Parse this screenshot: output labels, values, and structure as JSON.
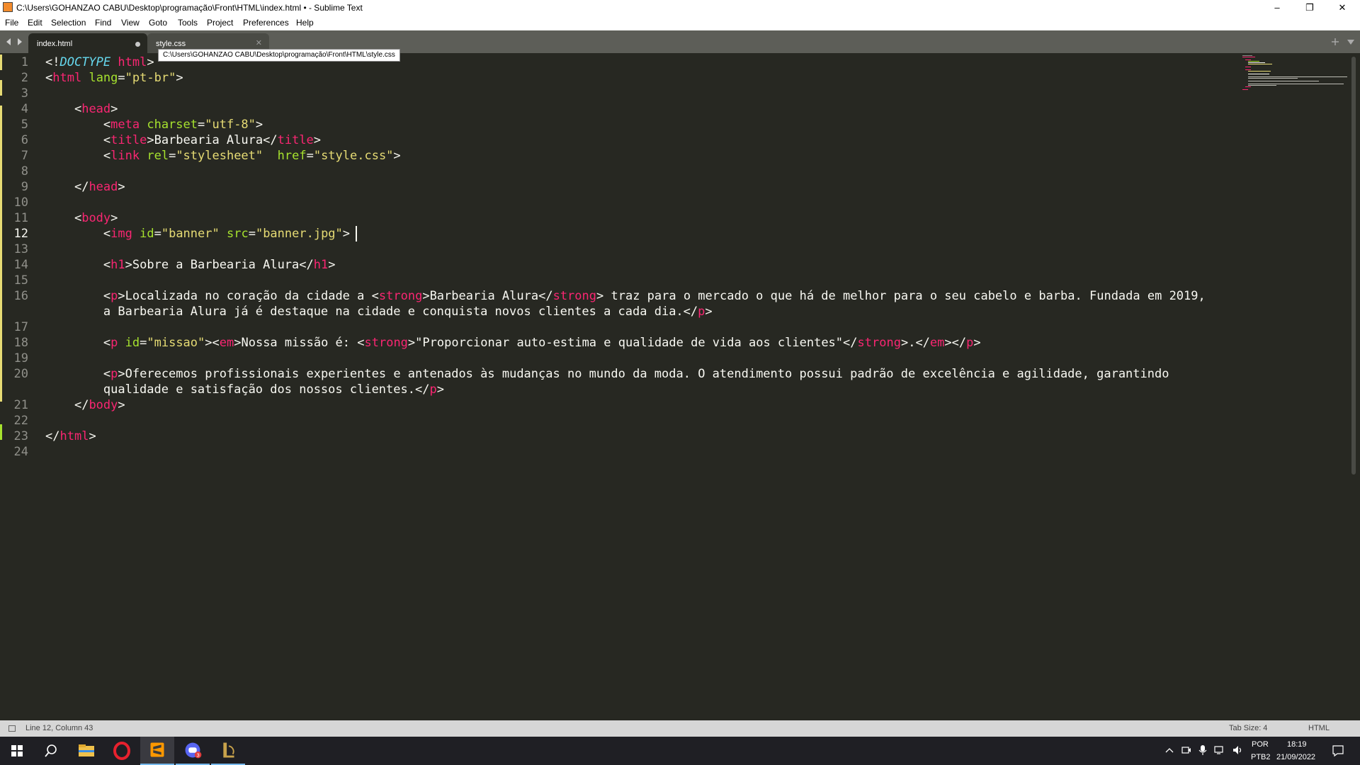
{
  "window": {
    "title": "C:\\Users\\GOHANZAO CABU\\Desktop\\programação\\Front\\HTML\\index.html • - Sublime Text",
    "controls": [
      "–",
      "❐",
      "✕"
    ]
  },
  "menu": [
    "File",
    "Edit",
    "Selection",
    "Find",
    "View",
    "Goto",
    "Tools",
    "Project",
    "Preferences",
    "Help"
  ],
  "tabs": [
    {
      "label": "index.html",
      "active": true,
      "dirty": true
    },
    {
      "label": "style.css",
      "active": false,
      "dirty": false
    }
  ],
  "tooltip": "C:\\Users\\GOHANZAO CABU\\Desktop\\programação\\Front\\HTML\\style.css",
  "editor": {
    "line_numbers": [
      "1",
      "2",
      "3",
      "4",
      "5",
      "6",
      "7",
      "8",
      "9",
      "10",
      "11",
      "12",
      "13",
      "14",
      "15",
      "16",
      "17",
      "18",
      "19",
      "20",
      "21",
      "22",
      "23",
      "24"
    ],
    "active_line": "12"
  },
  "status": {
    "position": "Line 12, Column 43",
    "tab_size": "Tab Size: 4",
    "syntax": "HTML"
  },
  "taskbar": {
    "apps": [
      "windows-start",
      "search",
      "file-explorer",
      "opera",
      "sublime-text",
      "discord",
      "league-client"
    ],
    "lang_1": "POR",
    "lang_2": "PTB2",
    "time": "18:19",
    "date": "21/09/2022",
    "discord_badge": "3"
  },
  "colors": {
    "background": "#272822",
    "tag": "#f92672",
    "attribute": "#a6e22e",
    "string": "#e6db74",
    "doctype": "#66d9ef",
    "text": "#f8f8f2"
  }
}
